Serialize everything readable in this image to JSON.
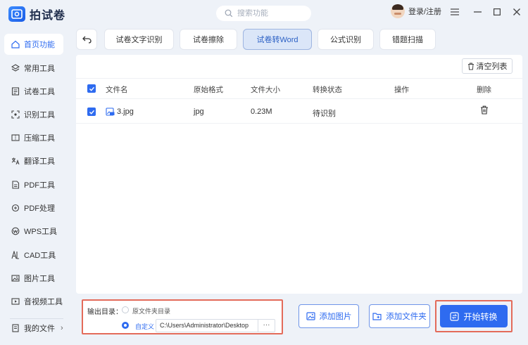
{
  "app": {
    "name": "拍试卷",
    "search_placeholder": "搜索功能",
    "login_label": "登录/注册"
  },
  "sidebar": {
    "items": [
      {
        "label": "首页功能",
        "icon": "home-icon",
        "active": true
      },
      {
        "label": "常用工具",
        "icon": "layers-icon"
      },
      {
        "label": "试卷工具",
        "icon": "paper-icon"
      },
      {
        "label": "识别工具",
        "icon": "scan-icon"
      },
      {
        "label": "压缩工具",
        "icon": "compress-icon"
      },
      {
        "label": "翻译工具",
        "icon": "translate-icon"
      },
      {
        "label": "PDF工具",
        "icon": "pdf-icon"
      },
      {
        "label": "PDF处理",
        "icon": "pdf-process-icon"
      },
      {
        "label": "WPS工具",
        "icon": "wps-icon"
      },
      {
        "label": "CAD工具",
        "icon": "cad-icon"
      },
      {
        "label": "图片工具",
        "icon": "image-icon"
      },
      {
        "label": "音视频工具",
        "icon": "video-icon"
      }
    ],
    "my_files_label": "我的文件",
    "my_files_chevron": "›"
  },
  "tabs": [
    {
      "label": "试卷文字识别"
    },
    {
      "label": "试卷擦除"
    },
    {
      "label": "试卷转Word",
      "active": true
    },
    {
      "label": "公式识别"
    },
    {
      "label": "错题扫描"
    }
  ],
  "toolbar": {
    "clear_label": "清空列表"
  },
  "table": {
    "headers": [
      "文件名",
      "原始格式",
      "文件大小",
      "转换状态",
      "操作",
      "删除"
    ],
    "rows": [
      {
        "name": "3.jpg",
        "format": "jpg",
        "size": "0.23M",
        "status": "待识别",
        "action": ""
      }
    ]
  },
  "output": {
    "label": "输出目录：",
    "option_source": "原文件夹目录",
    "option_custom": "自定义",
    "path": "C:\\Users\\Administrator\\Desktop",
    "more": "···"
  },
  "actions": {
    "add_image": "添加图片",
    "add_folder": "添加文件夹",
    "start": "开始转换"
  },
  "colors": {
    "accent": "#2e6bf0",
    "highlight_border": "#e36b5a",
    "background": "#eef2f8"
  }
}
